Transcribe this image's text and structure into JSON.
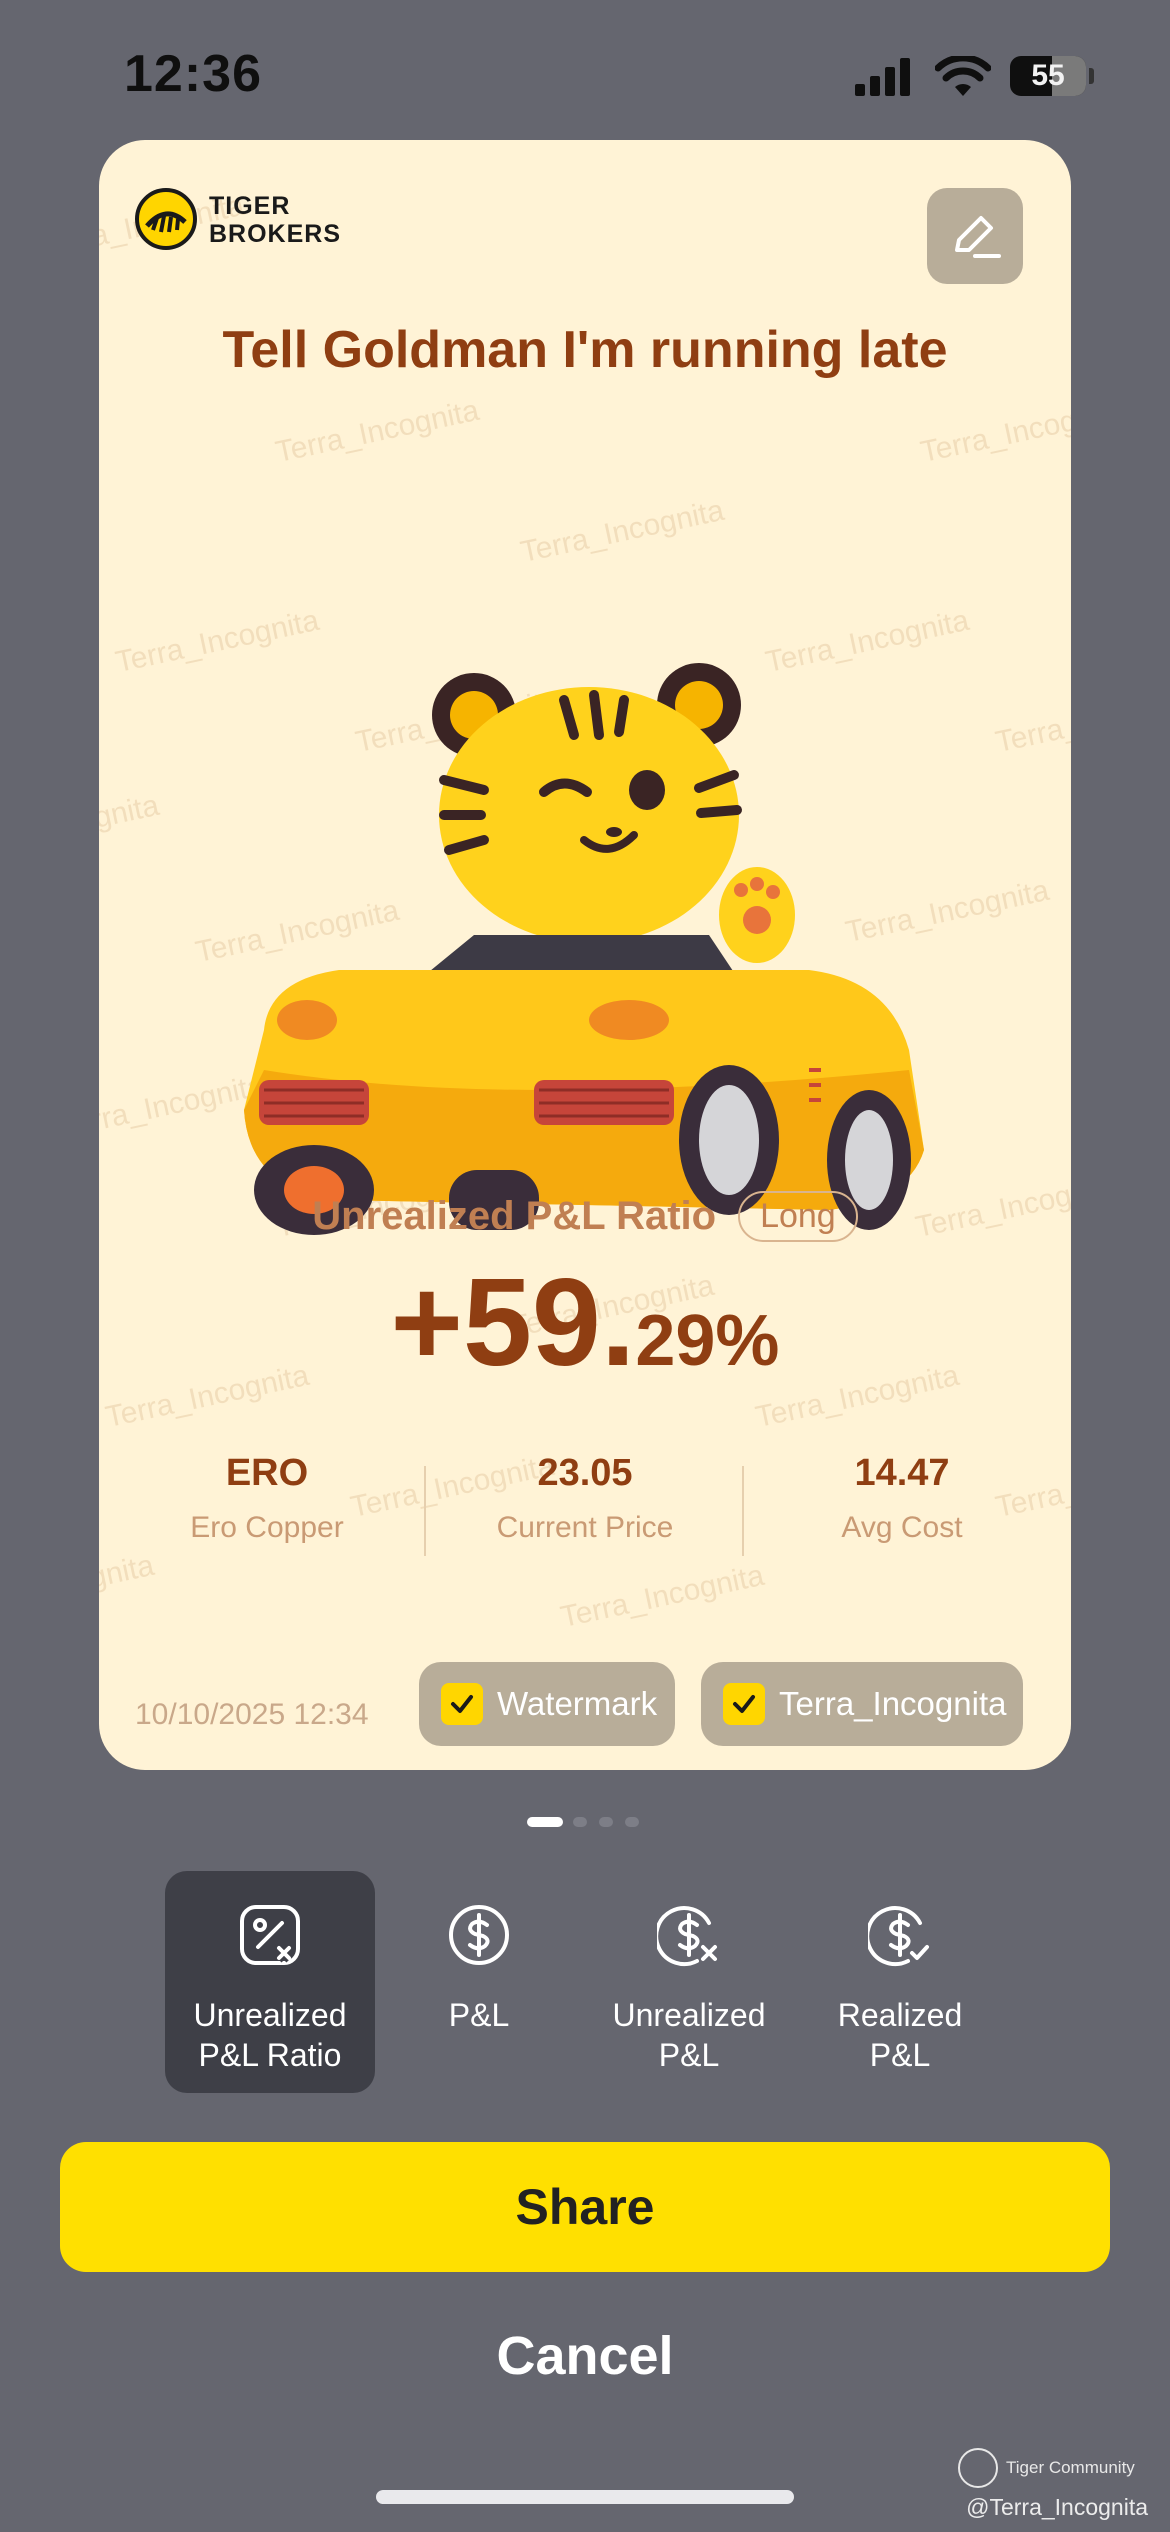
{
  "status_bar": {
    "time": "12:36",
    "battery": "55"
  },
  "card": {
    "logo_text": "TIGER\nBROKERS",
    "title": "Tell Goldman I'm running late",
    "watermark_text": "Terra_Incognita",
    "ratio_label": "Unrealized P&L Ratio",
    "position_type": "Long",
    "ratio_value_integer": "+59.",
    "ratio_value_decimal": "29%",
    "stats": [
      {
        "value": "ERO",
        "label": "Ero Copper"
      },
      {
        "value": "23.05",
        "label": "Current Price"
      },
      {
        "value": "14.47",
        "label": "Avg Cost"
      }
    ],
    "timestamp": "10/10/2025 12:34",
    "toggles": [
      {
        "label": "Watermark",
        "checked": true
      },
      {
        "label": "Terra_Incognita",
        "checked": true
      }
    ]
  },
  "pager": {
    "pages": 4,
    "active": 0
  },
  "tabs": [
    {
      "label": "Unrealized\nP&L Ratio",
      "icon": "percent-icon",
      "active": true
    },
    {
      "label": "P&L",
      "icon": "dollar-icon",
      "active": false
    },
    {
      "label": "Unrealized\nP&L",
      "icon": "dollar-x-icon",
      "active": false
    },
    {
      "label": "Realized\nP&L",
      "icon": "dollar-check-icon",
      "active": false
    }
  ],
  "actions": {
    "share": "Share",
    "cancel": "Cancel"
  },
  "footer": {
    "community": "Tiger Community",
    "user": "@Terra_Incognita"
  },
  "colors": {
    "background": "#65666f",
    "card": "#fff3d6",
    "accent_yellow": "#ffe000",
    "title_brown": "#8f3e12",
    "label_tan": "#c07f52"
  }
}
